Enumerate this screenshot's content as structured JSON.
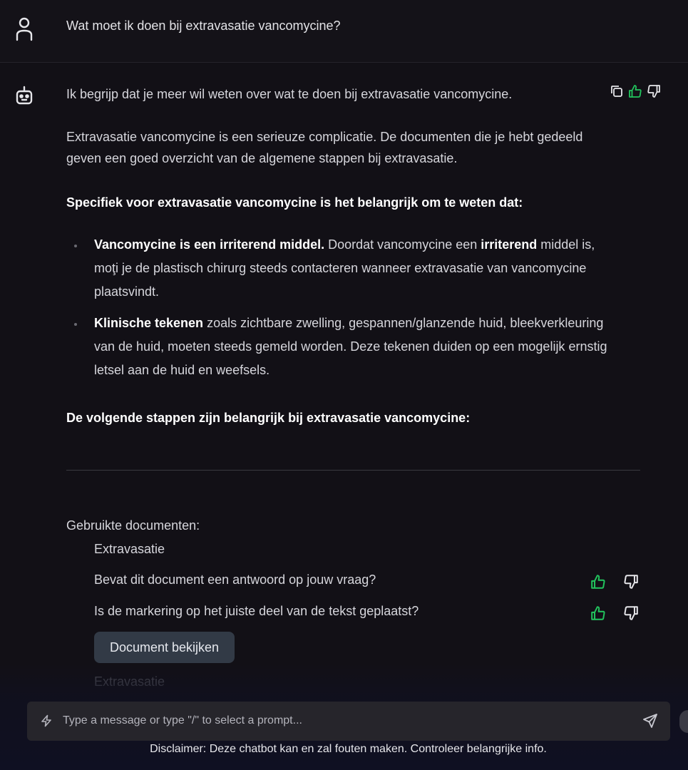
{
  "user_message": {
    "text": "Wat moet ik doen bij extravasatie vancomycine?"
  },
  "bot_message": {
    "intro": "Ik begrijp dat je meer wil weten over wat te doen bij extravasatie vancomycine.",
    "paragraph1": "Extravasatie vancomycine is een serieuze complicatie. De documenten die je hebt gedeeld geven een goed overzicht van de algemene stappen bij extravasatie.",
    "heading1": "Specifiek voor extravasatie vancomycine is het belangrijk om te weten dat:",
    "bullets": [
      {
        "bold": "Vancomycine is een irriterend middel.",
        "text1": " Doordat vancomycine een ",
        "bold2": "irriterend",
        "text2": " middel is, moţi je de plastisch chirurg steeds contacteren wanneer extravasatie van vancomycine plaatsvindt."
      },
      {
        "bold": "Klinische tekenen",
        "text1": " zoals zichtbare zwelling, gespannen/glanzende huid, bleekverkleuring van de huid, moeten steeds gemeld worden. Deze tekenen duiden op een mogelijk ernstig letsel aan de huid en weefsels."
      }
    ],
    "heading2": "De volgende stappen zijn belangrijk bij extravasatie vancomycine:",
    "actions": {
      "copy_icon": "copy-icon",
      "like_icon": "thumbs-up-icon",
      "dislike_icon": "thumbs-down-icon"
    }
  },
  "documents": {
    "title": "Gebruikte documenten:",
    "items": [
      {
        "name": "Extravasatie",
        "questions": [
          "Bevat dit document een antwoord op jouw vraag?",
          "Is de markering op het juiste deel van de tekst geplaatst?"
        ],
        "button_label": "Document bekijken"
      },
      {
        "name": "Extravasatie"
      }
    ]
  },
  "input": {
    "placeholder": "Type a message or type \"/\" to select a prompt...",
    "value": ""
  },
  "disclaimer": "Disclaimer: Deze chatbot kan en zal fouten maken. Controleer belangrijke info.",
  "colors": {
    "accent_green": "#22c55e",
    "button_bg": "#323a46",
    "background": "#121016"
  }
}
